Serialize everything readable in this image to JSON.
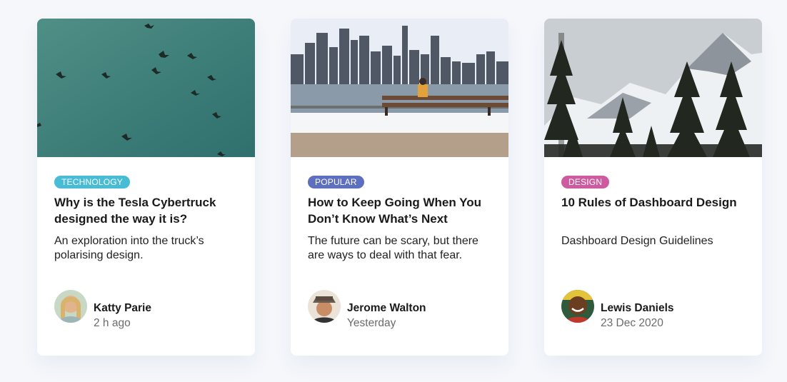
{
  "cards": [
    {
      "image": "flock-of-birds-photo",
      "tag": {
        "label": "TECHNOLOGY",
        "color": "#47bcd4"
      },
      "title": "Why is the Tesla Cybertruck designed the way it is?",
      "description": "An exploration into the truck’s polarising design.",
      "author": {
        "name": "Katty Parie",
        "time": "2 h ago",
        "avatar": "woman-avatar"
      }
    },
    {
      "image": "city-skyline-bench-photo",
      "tag": {
        "label": "POPULAR",
        "color": "#5e6fbf"
      },
      "title": "How to Keep Going When You Don’t Know What’s Next",
      "description": "The future can be scary, but there are ways to deal with that fear.",
      "author": {
        "name": "Jerome Walton",
        "time": "Yesterday",
        "avatar": "man-with-hat-avatar"
      }
    },
    {
      "image": "snowy-mountain-forest-photo",
      "tag": {
        "label": "DESIGN",
        "color": "#cd5b9f"
      },
      "title": "10 Rules of Dashboard Design",
      "description": "Dashboard Design Guidelines",
      "author": {
        "name": "Lewis Daniels",
        "time": "23 Dec 2020",
        "avatar": "smiling-man-avatar"
      }
    }
  ]
}
